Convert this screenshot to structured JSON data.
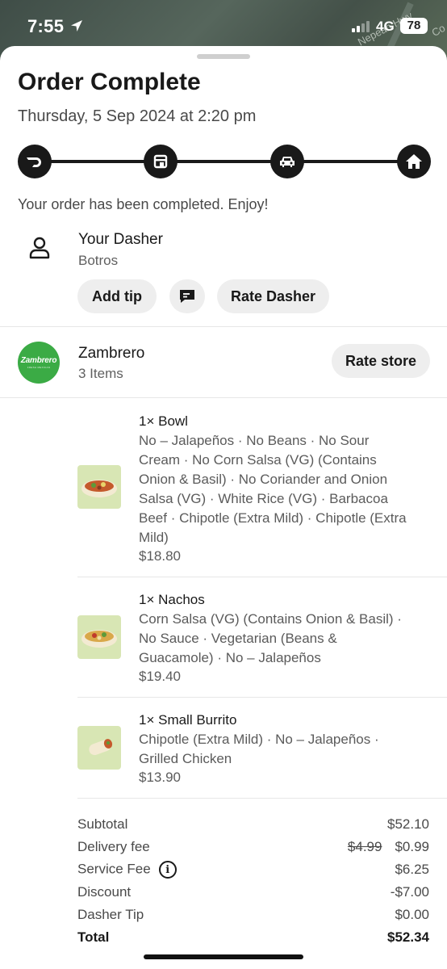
{
  "status_bar": {
    "time": "7:55",
    "network": "4G",
    "battery": "78",
    "map_label_1": "Nepean Hwy",
    "map_label_2": "Co"
  },
  "header": {
    "title": "Order Complete",
    "date": "Thursday, 5 Sep 2024 at 2:20 pm"
  },
  "tracker": {
    "steps": [
      "doordash-icon",
      "store-icon",
      "car-icon",
      "home-icon"
    ],
    "accent": "#191919"
  },
  "message": "Your order has been completed. Enjoy!",
  "dasher": {
    "title": "Your Dasher",
    "name": "Botros",
    "add_tip_label": "Add tip",
    "rate_label": "Rate Dasher"
  },
  "store": {
    "logo_text": "Zambrero",
    "logo_subtext": "FRESH MEXICAN",
    "logo_color": "#3bab45",
    "name": "Zambrero",
    "items_count": "3 Items",
    "rate_label": "Rate store"
  },
  "items": [
    {
      "name": "1× Bowl",
      "description": "No – Jalapeños · No Beans · No Sour Cream · No Corn Salsa (VG) (Contains Onion & Basil) · No Coriander and Onion Salsa (VG) · White Rice (VG) · Barbacoa Beef · Chipotle (Extra Mild) · Chipotle (Extra Mild)",
      "price": "$18.80"
    },
    {
      "name": "1× Nachos",
      "description": "Corn Salsa (VG) (Contains Onion & Basil) · No Sauce · Vegetarian (Beans & Guacamole) · No – Jalapeños",
      "price": "$19.40"
    },
    {
      "name": "1× Small Burrito",
      "description": "Chipotle (Extra Mild) · No – Jalapeños · Grilled Chicken",
      "price": "$13.90"
    }
  ],
  "summary": {
    "subtotal_label": "Subtotal",
    "subtotal_value": "$52.10",
    "delivery_label": "Delivery fee",
    "delivery_original": "$4.99",
    "delivery_value": "$0.99",
    "service_label": "Service Fee",
    "service_value": "$6.25",
    "discount_label": "Discount",
    "discount_value": "-$7.00",
    "tip_label": "Dasher Tip",
    "tip_value": "$0.00",
    "total_label": "Total",
    "total_value": "$52.34"
  }
}
